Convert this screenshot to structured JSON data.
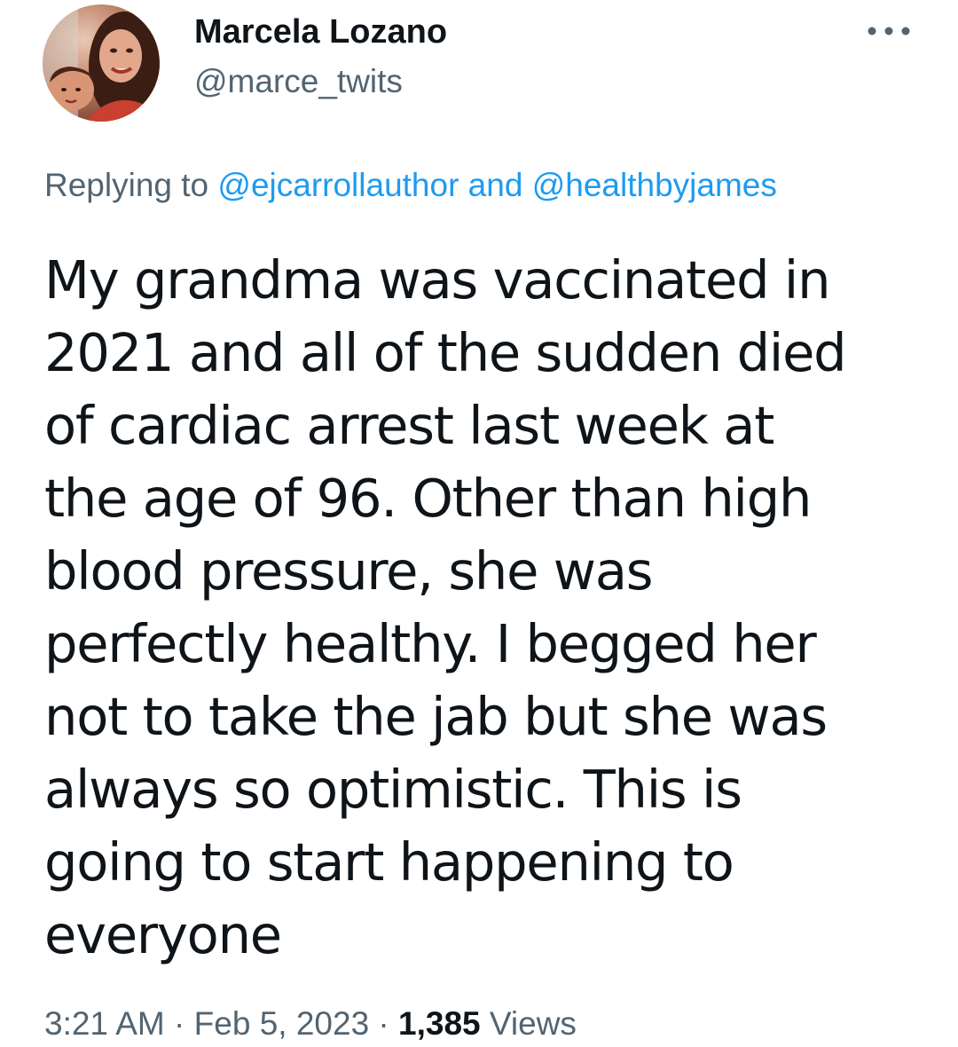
{
  "user": {
    "display_name": "Marcela Lozano",
    "handle": "@marce_twits"
  },
  "reply": {
    "prefix": "Replying to ",
    "mention_1": "@ejcarrollauthor",
    "conjunction": " and ",
    "mention_2": "@healthbyjames"
  },
  "tweet": {
    "text": "My grandma was vaccinated in\n2021 and all of the sudden died\nof cardiac arrest last week at\nthe age of 96. Other than high\nblood pressure, she was\nperfectly healthy. I begged her\nnot to take the jab but she was\nalways so optimistic. This is\ngoing to start happening to\neveryone"
  },
  "meta": {
    "time": "3:21 AM",
    "separator_1": " · ",
    "date": "Feb 5, 2023",
    "separator_2": " · ",
    "views_count": "1,385",
    "views_label": " Views"
  },
  "icons": {
    "more": "more-horizontal-icon"
  },
  "colors": {
    "text_primary": "#0f1419",
    "text_secondary": "#536471",
    "link": "#1d9bf0",
    "background": "#ffffff"
  }
}
